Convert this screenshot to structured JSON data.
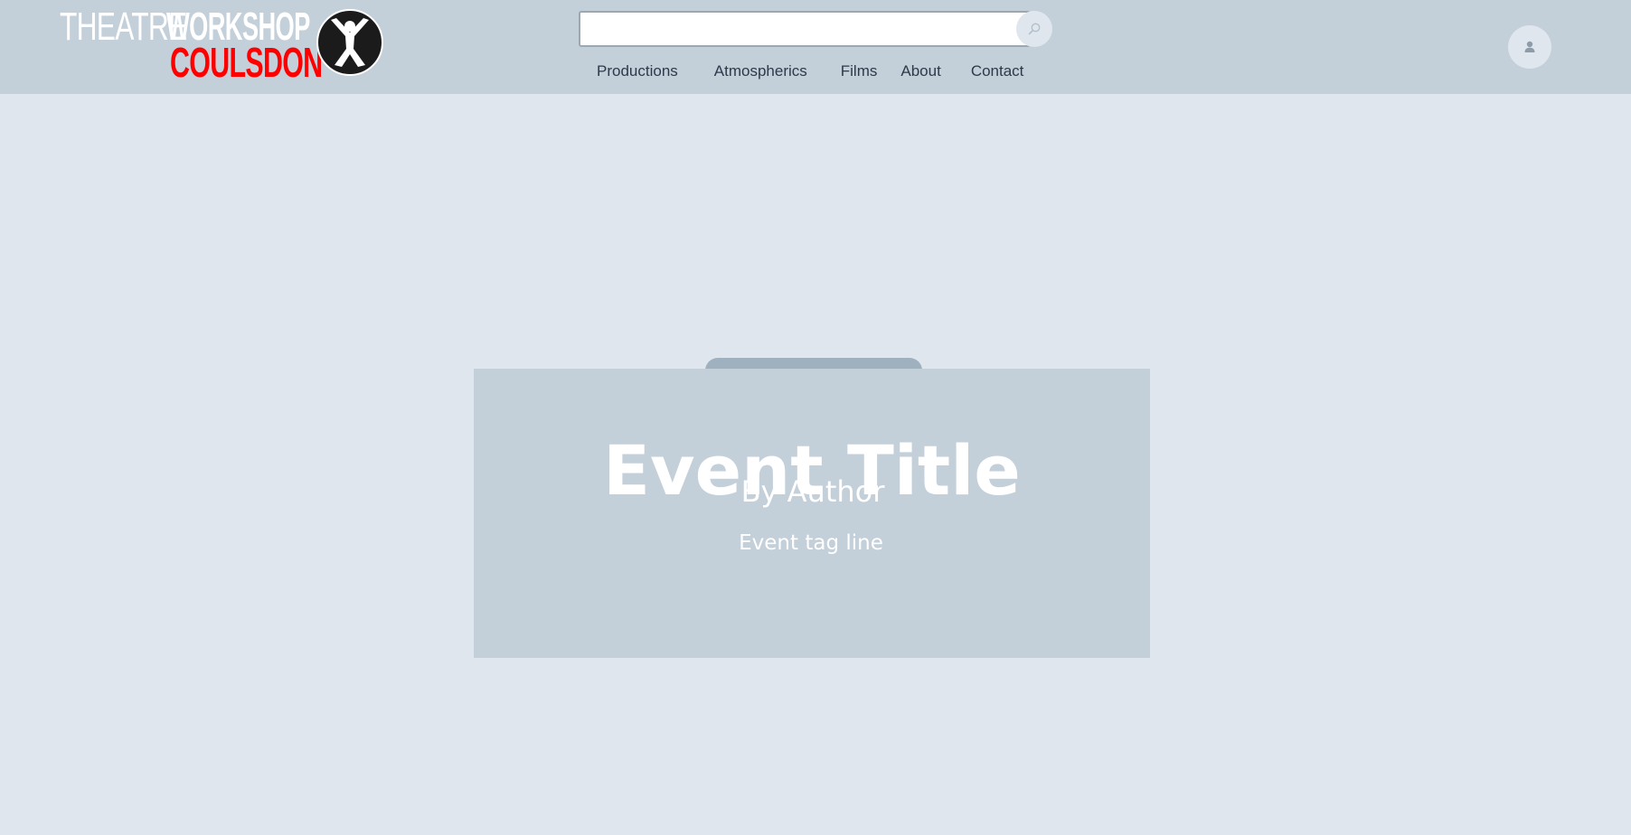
{
  "logo": {
    "line1_light": "THEATRE",
    "line1_bold": "WORKSHOP",
    "line2": "COULSDON",
    "emblem_icon": "leaping-figure-icon",
    "accent_color": "#ff0000"
  },
  "search": {
    "value": "",
    "placeholder": "",
    "button_icon": "search-icon"
  },
  "nav": {
    "items": [
      {
        "label": "Productions"
      },
      {
        "label": "Atmospherics"
      },
      {
        "label": "Films"
      },
      {
        "label": "About"
      },
      {
        "label": "Contact"
      }
    ]
  },
  "account": {
    "icon": "user-icon"
  },
  "event": {
    "title": "Event Title",
    "author": "By Author",
    "tagline": "Event tag line"
  },
  "colors": {
    "header_bg": "#c3cfd9",
    "page_bg": "#dfe6ee",
    "card_bg": "#c3cfd9",
    "card_tab": "#9fb0bf",
    "nav_text": "#2c3a4a"
  }
}
